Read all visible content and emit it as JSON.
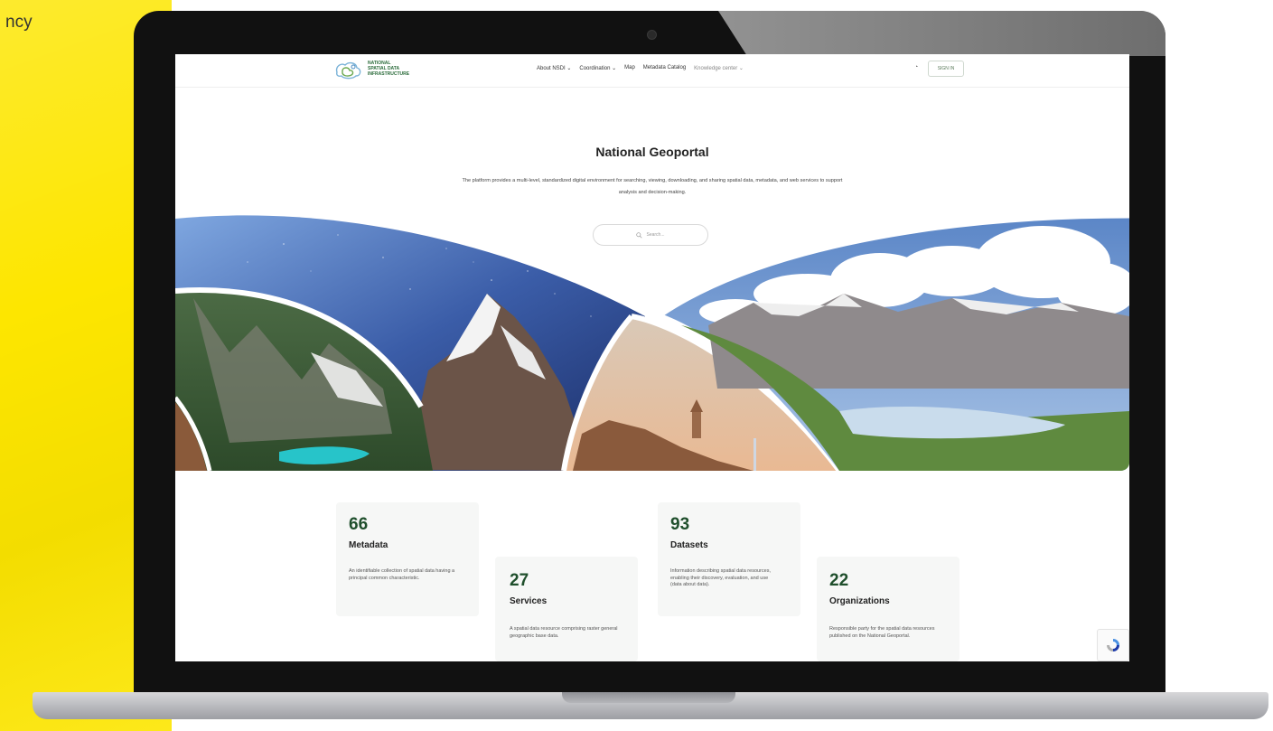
{
  "page": {
    "corner_text": "ncy"
  },
  "header": {
    "logo_lines": [
      "NATIONAL",
      "SPATIAL DATA",
      "INFRASTRUCTURE"
    ],
    "nav": [
      {
        "label": "About NSDI",
        "chevron": true
      },
      {
        "label": "Coordination",
        "chevron": true
      },
      {
        "label": "Map",
        "chevron": false
      },
      {
        "label": "Metadata Catalog",
        "chevron": false
      },
      {
        "label": "Knowledge center",
        "chevron": true
      }
    ],
    "signin_label": "SIGN IN"
  },
  "hero": {
    "title": "National Geoportal",
    "description": "The platform provides a multi-level, standardized digital environment for searching, viewing, downloading, and sharing spatial data, metadata, and web services to support analysis and decision-making.",
    "search_placeholder": "Search..."
  },
  "stats": [
    {
      "number": "66",
      "label": "Metadata",
      "description": "An identifiable collection of spatial data having a principal common characteristic."
    },
    {
      "number": "27",
      "label": "Services",
      "description": "A spatial data resource comprising raster general geographic base data."
    },
    {
      "number": "93",
      "label": "Datasets",
      "description": "Information describing spatial data resources, enabling their discovery, evaluation, and use (data about data)."
    },
    {
      "number": "22",
      "label": "Organizations",
      "description": "Responsible party for the spatial data resources published on the National Geoportal."
    }
  ],
  "colors": {
    "background_yellow": "#fde600",
    "brand_green": "#1f4f2c",
    "laptop_bezel": "#111111"
  }
}
